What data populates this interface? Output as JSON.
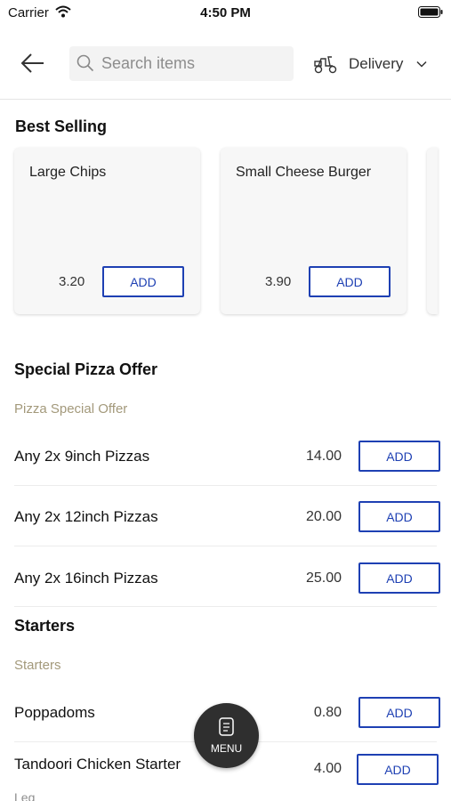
{
  "status_bar": {
    "carrier": "Carrier",
    "time": "4:50 PM"
  },
  "header": {
    "search_placeholder": "Search items",
    "delivery_label": "Delivery"
  },
  "best_selling": {
    "title": "Best Selling",
    "items": [
      {
        "name": "Large Chips",
        "price": "3.20",
        "add_label": "ADD"
      },
      {
        "name": "Small Cheese Burger",
        "price": "3.90",
        "add_label": "ADD"
      }
    ]
  },
  "special_pizza": {
    "title": "Special Pizza Offer",
    "subtitle": "Pizza Special Offer",
    "items": [
      {
        "name": "Any 2x 9inch Pizzas",
        "price": "14.00",
        "add_label": "ADD"
      },
      {
        "name": "Any 2x 12inch Pizzas",
        "price": "20.00",
        "add_label": "ADD"
      },
      {
        "name": "Any 2x 16inch Pizzas",
        "price": "25.00",
        "add_label": "ADD"
      }
    ]
  },
  "starters": {
    "title": "Starters",
    "subtitle": "Starters",
    "items": [
      {
        "name": "Poppadoms",
        "price": "0.80",
        "add_label": "ADD"
      },
      {
        "name": "Tandoori Chicken Starter",
        "price": "4.00",
        "add_label": "ADD",
        "description": "Leg"
      }
    ]
  },
  "fab": {
    "label": "MENU"
  },
  "colors": {
    "accent": "#1e40b3",
    "subtitle": "#a3997b",
    "fab": "#2f2f2f"
  }
}
